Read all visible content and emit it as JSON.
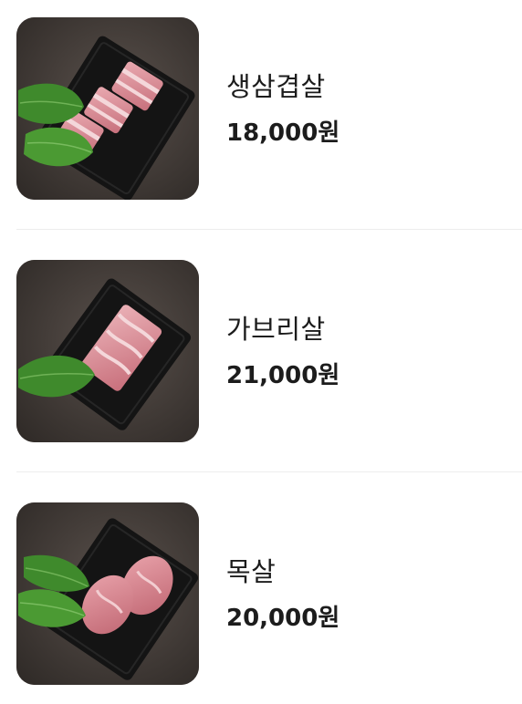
{
  "menu": {
    "items": [
      {
        "name": "생삼겹살",
        "price": "18,000원",
        "image": "pork-belly-photo"
      },
      {
        "name": "가브리살",
        "price": "21,000원",
        "image": "pork-jowl-photo"
      },
      {
        "name": "목살",
        "price": "20,000원",
        "image": "pork-neck-photo"
      }
    ]
  },
  "colors": {
    "background": "#ffffff",
    "text": "#1c1c1c",
    "divider": "#ededed",
    "photo_backdrop": "#413a36",
    "plate": "#141414",
    "leaf": "#3f8a2c",
    "meat": "#d98e96"
  }
}
